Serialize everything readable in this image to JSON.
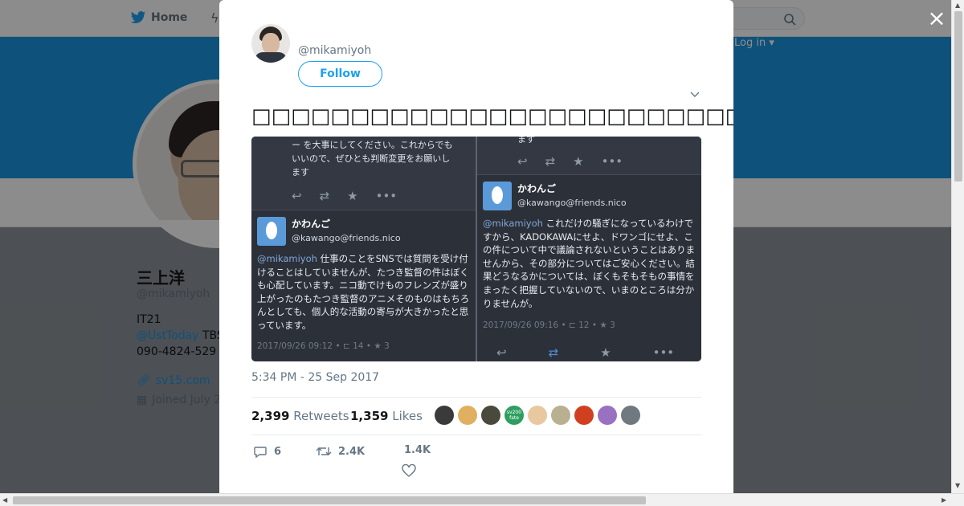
{
  "nav": {
    "home_label": "Home",
    "login_label": "Log in ▾"
  },
  "profile": {
    "name": "三上洋",
    "handle": "@mikamiyoh",
    "bio_line1": "IT21",
    "bio_mention": "@UstToday",
    "bio_mention_suffix": " TBS",
    "bio_phone": "090-4824-529",
    "url": "sv15.com",
    "joined": "Joined July 2"
  },
  "tweet": {
    "handle": "@mikamiyoh",
    "follow_label": "Follow",
    "text": "□□□□□□□□□□□□□□□□□□□□□□□□□□□□□□□□□□□□□□□□□□□□□□□□□□",
    "timestamp": "5:34 PM - 25 Sep 2017",
    "retweets_count": "2,399",
    "retweets_label": "Retweets",
    "likes_count": "1,359",
    "likes_label": "Likes",
    "reply_count": "6",
    "retweet_action_count": "2.4K",
    "like_action_count": "1.4K",
    "liker_colors": [
      "#3a3a3a",
      "#e0b060",
      "#4a4a3c",
      "#2e9e60",
      "#e8c8a0",
      "#b8b090",
      "#d04020",
      "#9a70c0",
      "#707880"
    ],
    "liker_labels": [
      "",
      "",
      "",
      "sv200 fate",
      "",
      "",
      "",
      "",
      ""
    ]
  },
  "media": {
    "left": {
      "cut_text": "ー を大事にしてください。これからでも\nいいので、ぜひとも判断変更をお願いし\nます",
      "user_name": "かわんご",
      "user_handle": "@kawango@friends.nico",
      "mention": "@mikamiyoh",
      "body": " 仕事のことをSNSでは質問を受け付けることはしていませんが、たつき監督の件はぼくも心配しています。ニコ動でけものフレンズが盛り上がったのもたつき監督のアニメそのものはもちろんとしても、個人的な活動の寄与が大きかったと思っています。",
      "meta": "2017/09/26 09:12 • ⊏ 14 • ★ 3"
    },
    "right": {
      "cut_text": "ます",
      "user_name": "かわんご",
      "user_handle": "@kawango@friends.nico",
      "mention": "@mikamiyoh",
      "body": " これだけの騒ぎになっているわけですから、KADOKAWAにせよ、ドワンゴにせよ、この件について中で議論されないということはありませんから、その部分についてはご安心ください。結果どうなるかについては、ぼくもそもそもの事情をまったく把握していないので、いまのところは分かりませんが。",
      "meta": "2017/09/26 09:16 • ⊏ 12 • ★ 3"
    }
  },
  "icons": {
    "close": "×",
    "reply": "reply-icon",
    "retweet": "retweet-icon",
    "like": "heart-icon",
    "more": "more-icon"
  },
  "colors": {
    "accent": "#1da1f2",
    "banner": "#1b95e0",
    "media_bg": "#2c3039"
  }
}
